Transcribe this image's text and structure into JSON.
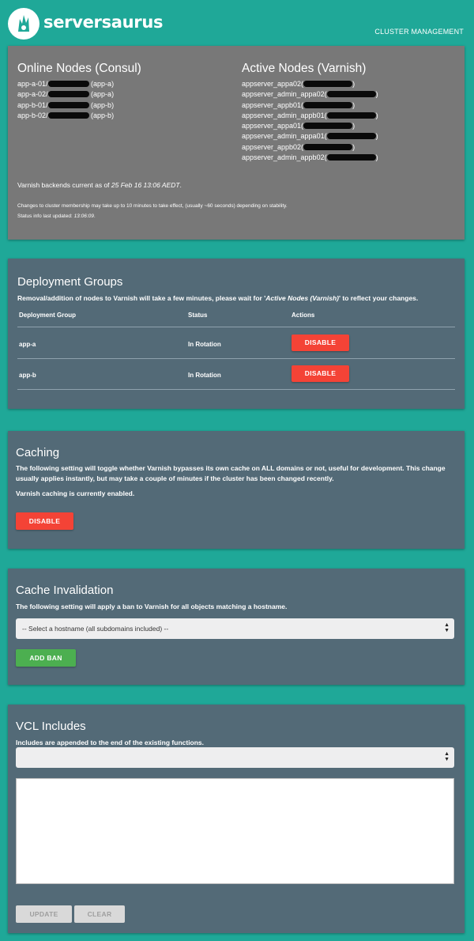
{
  "header": {
    "logo_text": "serversaurus",
    "nav_link": "CLUSTER MANAGEMENT"
  },
  "status_panel": {
    "online_title": "Online Nodes (Consul)",
    "online_nodes": [
      {
        "name": "app-a-01/",
        "group": "(app-a)"
      },
      {
        "name": "app-a-02/",
        "group": "(app-a)"
      },
      {
        "name": "app-b-01/",
        "group": "(app-b)"
      },
      {
        "name": "app-b-02/",
        "group": "(app-b)"
      }
    ],
    "active_title": "Active Nodes (Varnish)",
    "active_nodes": [
      {
        "name": "appserver_appa02(",
        "suffix": ")"
      },
      {
        "name": "appserver_admin_appa02(",
        "suffix": ")"
      },
      {
        "name": "appserver_appb01(",
        "suffix": ")"
      },
      {
        "name": "appserver_admin_appb01(",
        "suffix": ")"
      },
      {
        "name": "appserver_appa01(",
        "suffix": ")"
      },
      {
        "name": "appserver_admin_appa01(",
        "suffix": ")"
      },
      {
        "name": "appserver_appb02(",
        "suffix": ")"
      },
      {
        "name": "appserver_admin_appb02(",
        "suffix": ")"
      }
    ],
    "backends_prefix": "Varnish backends current as of ",
    "backends_time": "25 Feb 16 13:06 AEDT",
    "backends_suffix": ".",
    "membership_note": "Changes to cluster membership may take up to 10 minutes to take effect, (usually ~60 seconds) depending on stability.",
    "status_prefix": "Status info last updated: ",
    "status_time": "13:06:09",
    "status_suffix": "."
  },
  "deployment": {
    "title": "Deployment Groups",
    "desc_prefix": "Removal/addition of nodes to Varnish will take a few minutes, please wait for '",
    "desc_em": "Active Nodes (Varnish)",
    "desc_suffix": "' to reflect your changes.",
    "columns": [
      "Deployment Group",
      "Status",
      "Actions"
    ],
    "rows": [
      {
        "group": "app-a",
        "status": "In Rotation",
        "action": "DISABLE"
      },
      {
        "group": "app-b",
        "status": "In Rotation",
        "action": "DISABLE"
      }
    ]
  },
  "caching": {
    "title": "Caching",
    "desc": "The following setting will toggle whether Varnish bypasses its own cache on ALL domains or not, useful for development. This change usually applies instantly, but may take a couple of minutes if the cluster has been changed recently.",
    "state_prefix": "Varnish caching is currently ",
    "state_value": "enabled",
    "state_suffix": ".",
    "button": "DISABLE"
  },
  "invalidation": {
    "title": "Cache Invalidation",
    "desc": "The following setting will apply a ban to Varnish for all objects matching a hostname.",
    "select_value": "-- Select a hostname (all subdomains included) --",
    "button": "ADD BAN"
  },
  "vcl": {
    "title": "VCL Includes",
    "desc": "Includes are appended to the end of the existing functions.",
    "select_value": "",
    "textarea_value": "",
    "update_button": "UPDATE",
    "clear_button": "CLEAR"
  },
  "colors": {
    "background": "#1fa898",
    "status_panel": "#787878",
    "panel": "#536a77",
    "danger": "#f44336",
    "success": "#4caf50"
  }
}
